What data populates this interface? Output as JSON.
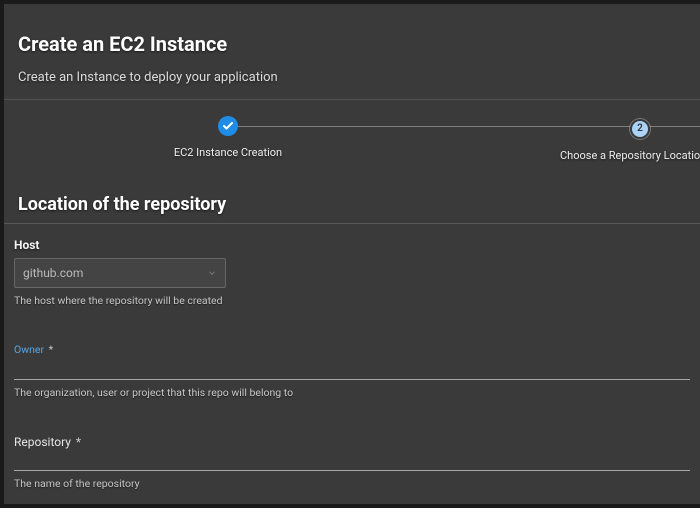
{
  "header": {
    "title": "Create an EC2 Instance",
    "subtitle": "Create an Instance to deploy your application"
  },
  "stepper": {
    "steps": [
      {
        "number": "1",
        "label": "EC2 Instance Creation",
        "state": "complete"
      },
      {
        "number": "2",
        "label": "Choose a Repository Location",
        "state": "active"
      }
    ]
  },
  "section": {
    "title": "Location of the repository"
  },
  "fields": {
    "host": {
      "label": "Host",
      "value": "github.com",
      "help": "The host where the repository will be created"
    },
    "owner": {
      "label": "Owner",
      "required_mark": " *",
      "value": "",
      "help": "The organization, user or project that this repo will belong to"
    },
    "repository": {
      "label": "Repository",
      "required_mark": " *",
      "value": "",
      "help": "The name of the repository"
    }
  }
}
